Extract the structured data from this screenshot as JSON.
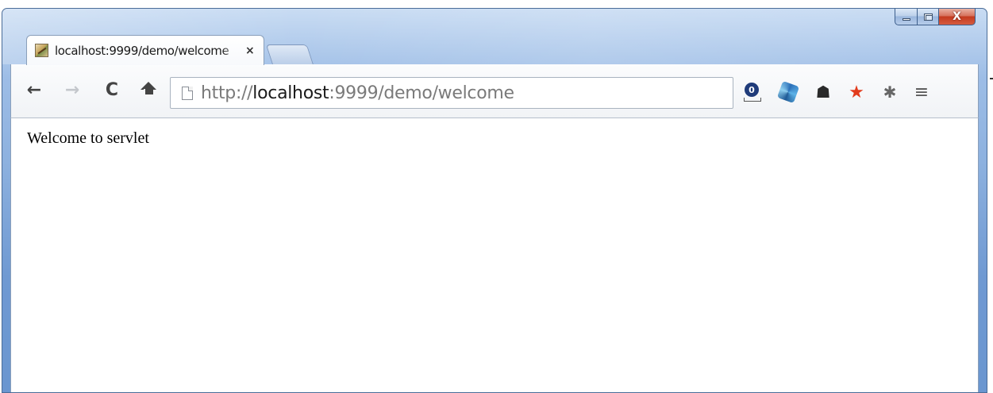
{
  "window": {
    "caption_buttons": [
      {
        "name": "minimize",
        "icon": "minimize-icon"
      },
      {
        "name": "maximize",
        "icon": "maximize-icon"
      },
      {
        "name": "close",
        "icon": "close-icon",
        "glyph": "X",
        "color": "#c33a1f"
      }
    ]
  },
  "tabs": [
    {
      "title": "localhost:9999/demo/welcome",
      "close_glyph": "×",
      "active": true,
      "icon": "favicon-icon"
    }
  ],
  "toolbar": {
    "back_glyph": "←",
    "forward_glyph": "→",
    "reload_glyph": "C",
    "home_icon": "home-icon",
    "url": {
      "scheme": "http://",
      "host": "localhost",
      "rest": ":9999/demo/welcome"
    },
    "extensions": [
      {
        "name": "extension-badge",
        "icon": "user-badge-icon",
        "badge_text": "0"
      },
      {
        "name": "extension-swirl",
        "icon": "swirl-icon"
      },
      {
        "name": "extension-profile",
        "icon": "profile-icon",
        "glyph": "☗"
      },
      {
        "name": "extension-star",
        "icon": "star-icon",
        "glyph": "★",
        "color": "#e23b1c"
      },
      {
        "name": "extension-puzzle",
        "icon": "puzzle-icon",
        "glyph": "✱"
      }
    ],
    "menu_glyph": "≡"
  },
  "page": {
    "body_text": "Welcome to servlet"
  }
}
